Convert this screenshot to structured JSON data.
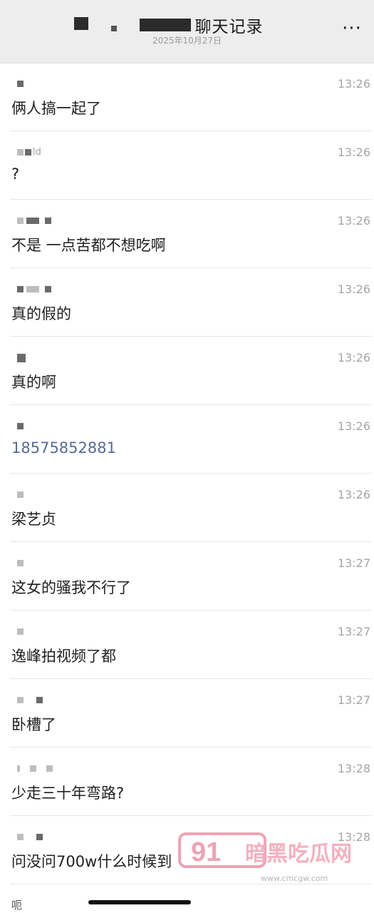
{
  "header": {
    "title": "聊天记录",
    "date": "2025年10月27日",
    "more_label": "···"
  },
  "messages": [
    {
      "sender": "",
      "time": "13:26",
      "text": "俩人搞一起了"
    },
    {
      "sender": "ld",
      "time": "13:26",
      "text": "?"
    },
    {
      "sender": "",
      "time": "13:26",
      "text": "不是 一点苦都不想吃啊"
    },
    {
      "sender": "",
      "time": "13:26",
      "text": "真的假的"
    },
    {
      "sender": "",
      "time": "13:26",
      "text": "真的啊"
    },
    {
      "sender": "",
      "time": "13:26",
      "text": "18575852881"
    },
    {
      "sender": "",
      "time": "13:26",
      "text": "梁艺贞"
    },
    {
      "sender": "",
      "time": "13:27",
      "text": "这女的骚我不行了"
    },
    {
      "sender": "",
      "time": "13:27",
      "text": "逸峰拍视频了都"
    },
    {
      "sender": "",
      "time": "13:27",
      "text": "卧槽了"
    },
    {
      "sender": "",
      "time": "13:28",
      "text": "少走三十年弯路?"
    },
    {
      "sender": "",
      "time": "13:28",
      "text": "问没问700w什么时候到"
    },
    {
      "sender": "",
      "time": "",
      "text": "呃"
    }
  ],
  "watermark": {
    "badge": "91",
    "name": "暗黑吃瓜网",
    "url": "www.cmcgw.com"
  },
  "colors": {
    "header_bg": "#ededed",
    "link": "#576b95",
    "time": "#a5a5a5"
  }
}
